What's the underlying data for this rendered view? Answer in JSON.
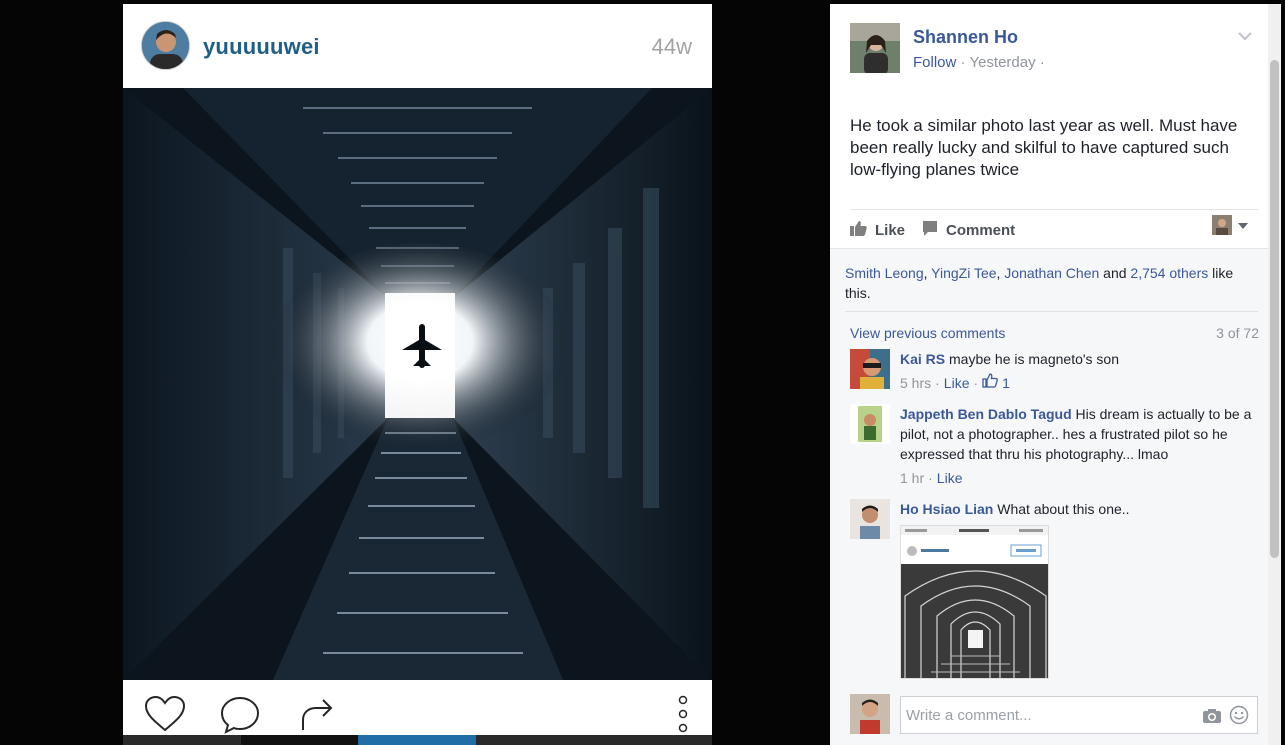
{
  "instagram_post": {
    "username": "yuuuuuwei",
    "age": "44w"
  },
  "facebook_post": {
    "author": "Shannen Ho",
    "follow_label": "Follow",
    "separator": "·",
    "time": "Yesterday",
    "trailing_separator": "·",
    "text": "He took a similar photo last year as well. Must have been really lucky and skilful to have captured such low-flying planes twice",
    "like_label": "Like",
    "comment_label": "Comment"
  },
  "likes_summary": {
    "name_1": "Smith Leong",
    "name_2": "YingZi Tee",
    "name_3": "Jonathan Chen",
    "and_text": "and",
    "others_link": "2,754 others",
    "suffix": "like this."
  },
  "comments_header": {
    "view_previous": "View previous comments",
    "count": "3 of 72"
  },
  "comments": [
    {
      "author": "Kai RS",
      "text": "maybe he is magneto's son",
      "time": "5 hrs",
      "like_label": "Like",
      "like_count": "1"
    },
    {
      "author": "Jappeth Ben Dablo Tagud",
      "text": "His dream is actually to be a pilot, not a photographer.. hes a frustrated pilot so he expressed that thru his photography... lmao",
      "time": "1 hr",
      "like_label": "Like"
    },
    {
      "author": "Ho Hsiao Lian",
      "text": "What about this one.."
    }
  ],
  "composer": {
    "placeholder": "Write a comment..."
  },
  "colors": {
    "facebook_link": "#3b5998",
    "instagram_username": "#1f5f86",
    "muted_text": "#90949c"
  },
  "icons": {
    "instagram_actions": [
      "heart-icon",
      "comment-bubble-icon",
      "share-icon",
      "more-dots-icon"
    ],
    "facebook_actions": [
      "thumbs-up-icon",
      "comment-icon",
      "chevron-down-icon",
      "camera-icon",
      "emoji-icon"
    ]
  }
}
